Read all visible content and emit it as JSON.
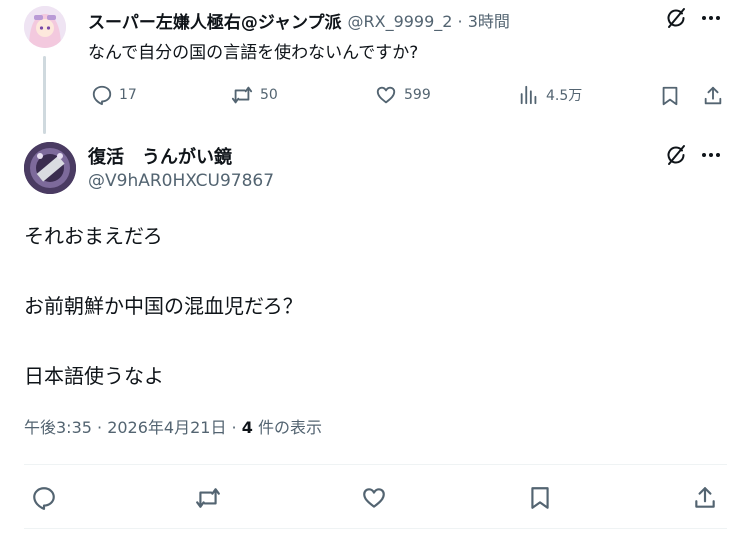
{
  "parent_tweet": {
    "name": "スーパー左嫌人極右@ジャンプ派",
    "handle_time": "@RX_9999_2 · 3時間",
    "text": "なんで自分の国の言語を使わないんですか?",
    "stats": {
      "replies": "17",
      "retweets": "50",
      "likes": "599",
      "views": "4.5万"
    }
  },
  "reply_tweet": {
    "name": "復活　うんがい鏡",
    "handle": "@V9hAR0HXCU97867",
    "lines": [
      "それおまえだろ",
      "お前朝鮮か中国の混血児だろ？",
      "日本語使うなよ"
    ],
    "meta_time": "午後3:35 · 2026年4月21日 · ",
    "meta_views_count": "4",
    "meta_views_label": " 件の表示"
  },
  "icons": {
    "grok": "grok-icon",
    "more": "more-icon",
    "reply": "reply-icon",
    "retweet": "retweet-icon",
    "like": "heart-icon",
    "views": "views-icon",
    "bookmark": "bookmark-icon",
    "share": "share-icon"
  },
  "colors": {
    "text": "#0f1419",
    "muted": "#536471",
    "line": "#cfd9de",
    "divider": "#eff3f4"
  }
}
